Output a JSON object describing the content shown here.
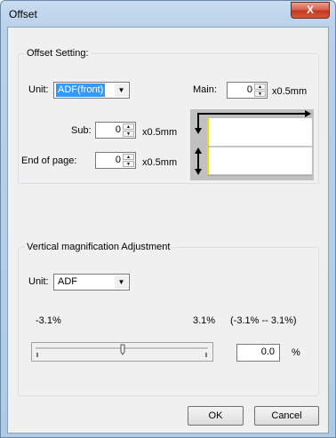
{
  "window": {
    "title": "Offset",
    "close_glyph": "X"
  },
  "offset_setting": {
    "group_label": "Offset Setting:",
    "unit_label": "Unit:",
    "unit_value": "ADF(front)",
    "main_label": "Main:",
    "main_value": "0",
    "main_unit": "x0.5mm",
    "sub_label": "Sub:",
    "sub_value": "0",
    "sub_unit": "x0.5mm",
    "eop_label": "End of page:",
    "eop_value": "0",
    "eop_unit": "x0.5mm"
  },
  "vertical_mag": {
    "group_label": "Vertical magnification Adjustment",
    "unit_label": "Unit:",
    "unit_value": "ADF",
    "min_label": "-3.1%",
    "max_label": "3.1%",
    "range_label": "(-3.1% -- 3.1%)",
    "value": "0.0",
    "percent_sign": "%"
  },
  "buttons": {
    "ok": "OK",
    "cancel": "Cancel"
  },
  "icons": {
    "dropdown": "chevron-down-icon",
    "spin_up": "spin-up-icon",
    "spin_down": "spin-down-icon"
  },
  "colors": {
    "selection": "#3399ff",
    "close": "#c3381f"
  }
}
